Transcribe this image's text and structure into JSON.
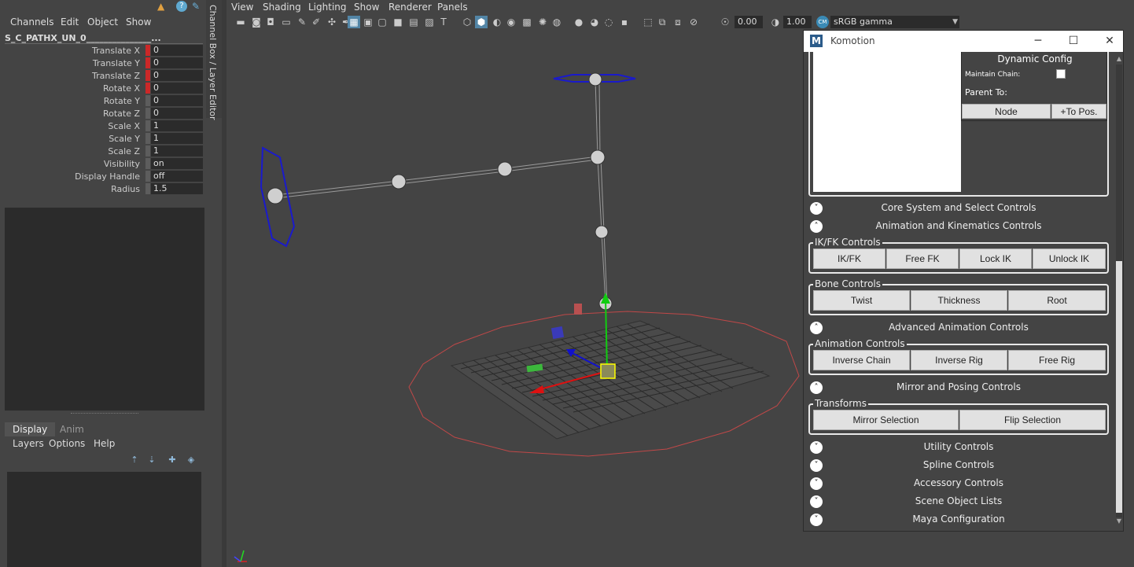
{
  "channel_box": {
    "menu": [
      "Channels",
      "Edit",
      "Object",
      "Show"
    ],
    "object_name": "S_C_PATHX_UN_0_______________...",
    "attributes": [
      {
        "label": "Translate X",
        "value": "0",
        "keyed": true
      },
      {
        "label": "Translate Y",
        "value": "0",
        "keyed": true
      },
      {
        "label": "Translate Z",
        "value": "0",
        "keyed": true
      },
      {
        "label": "Rotate X",
        "value": "0",
        "keyed": true
      },
      {
        "label": "Rotate Y",
        "value": "0",
        "keyed": false
      },
      {
        "label": "Rotate Z",
        "value": "0",
        "keyed": false
      },
      {
        "label": "Scale X",
        "value": "1",
        "keyed": false
      },
      {
        "label": "Scale Y",
        "value": "1",
        "keyed": false
      },
      {
        "label": "Scale Z",
        "value": "1",
        "keyed": false
      },
      {
        "label": "Visibility",
        "value": "on",
        "keyed": false
      },
      {
        "label": "Display Handle",
        "value": "off",
        "keyed": false
      },
      {
        "label": "Radius",
        "value": "1.5",
        "keyed": false
      }
    ],
    "side_tab": "Channel Box / Layer Editor"
  },
  "layer_editor": {
    "tabs": [
      "Display",
      "Anim"
    ],
    "menu": [
      "Layers",
      "Options",
      "Help"
    ]
  },
  "viewport": {
    "menu": [
      "View",
      "Shading",
      "Lighting",
      "Show",
      "Renderer",
      "Panels"
    ],
    "exposure": "0.00",
    "gamma": "1.00",
    "cm_badge": "CM",
    "colorspace": "sRGB gamma"
  },
  "komotion": {
    "title": "Komotion",
    "dynamic_config": {
      "title": "Dynamic Config",
      "maintain_chain_label": "Maintain Chain:",
      "parent_to_label": "Parent To:",
      "node_button": "Node",
      "to_pos_button": "+To Pos."
    },
    "sections": {
      "core": "Core System and Select Controls",
      "anim_kin": "Animation and Kinematics Controls",
      "advanced": "Advanced Animation Controls",
      "mirror": "Mirror and Posing Controls",
      "utility": "Utility Controls",
      "spline": "Spline Controls",
      "accessory": "Accessory Controls",
      "scene_lists": "Scene Object Lists",
      "maya_config": "Maya Configuration"
    },
    "groups": {
      "ikfk": {
        "label": "IK/FK Controls",
        "buttons": [
          "IK/FK",
          "Free FK",
          "Lock IK",
          "Unlock IK"
        ]
      },
      "bone": {
        "label": "Bone Controls",
        "buttons": [
          "Twist",
          "Thickness",
          "Root"
        ]
      },
      "animation": {
        "label": "Animation Controls",
        "buttons": [
          "Inverse Chain",
          "Inverse Rig",
          "Free Rig"
        ]
      },
      "transforms": {
        "label": "Transforms",
        "buttons": [
          "Mirror Selection",
          "Flip Selection"
        ]
      }
    }
  },
  "colors": {
    "keyed_attr": "#cc2828",
    "active_tool": "#5285a6",
    "selection_blue": "#1a1acc",
    "ground_circle": "#c04848"
  }
}
